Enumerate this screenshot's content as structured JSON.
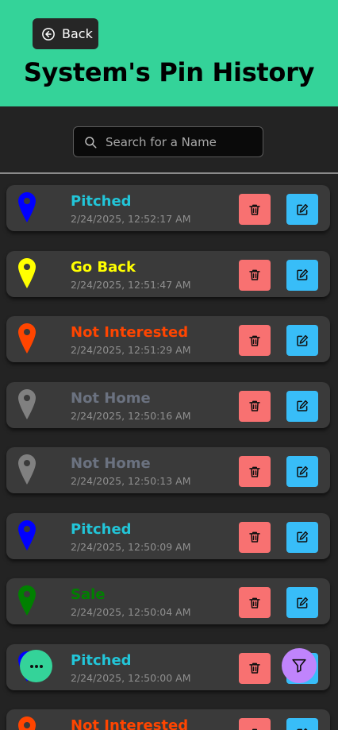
{
  "header": {
    "back_label": "Back",
    "title": "System's Pin History",
    "bg_color": "#34d399"
  },
  "search": {
    "placeholder": "Search for a Name",
    "value": ""
  },
  "entries": [
    {
      "status": "Pitched",
      "timestamp": "2/24/2025, 12:52:17 AM",
      "color": "#22c5d8",
      "pin_color": "#0000ff"
    },
    {
      "status": "Go Back",
      "timestamp": "2/24/2025, 12:51:47 AM",
      "color": "#ffff00",
      "pin_color": "#ffff00"
    },
    {
      "status": "Not Interested",
      "timestamp": "2/24/2025, 12:51:29 AM",
      "color": "#ff4500",
      "pin_color": "#ff4500"
    },
    {
      "status": "Not Home",
      "timestamp": "2/24/2025, 12:50:16 AM",
      "color": "#6b7280",
      "pin_color": "#808080"
    },
    {
      "status": "Not Home",
      "timestamp": "2/24/2025, 12:50:13 AM",
      "color": "#6b7280",
      "pin_color": "#808080"
    },
    {
      "status": "Pitched",
      "timestamp": "2/24/2025, 12:50:09 AM",
      "color": "#22c5d8",
      "pin_color": "#0000ff"
    },
    {
      "status": "Sale",
      "timestamp": "2/24/2025, 12:50:04 AM",
      "color": "#008000",
      "pin_color": "#008000"
    },
    {
      "status": "Pitched",
      "timestamp": "2/24/2025, 12:50:00 AM",
      "color": "#22c5d8",
      "pin_color": "#0000ff"
    },
    {
      "status": "Not Interested",
      "timestamp": "",
      "color": "#ff4500",
      "pin_color": "#ff4500"
    }
  ],
  "actions": {
    "delete_icon": "trash-icon",
    "edit_icon": "pencil-square-icon",
    "delete_color": "#f87171",
    "edit_color": "#38bdf8"
  },
  "fabs": {
    "more_icon": "ellipsis-icon",
    "filter_icon": "funnel-icon",
    "more_color": "#34d399",
    "filter_color": "#c084fc"
  }
}
